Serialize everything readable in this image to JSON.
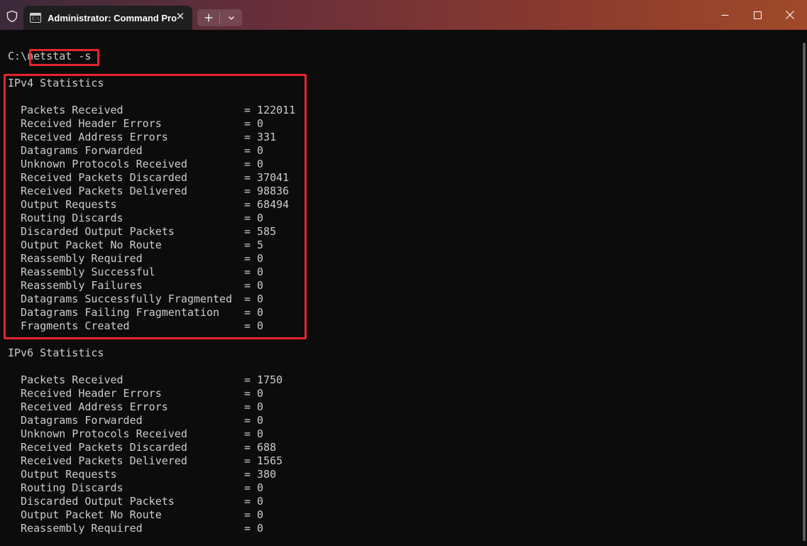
{
  "window": {
    "tab_title": "Administrator: Command Pro",
    "tab_icon_text": "C:\\",
    "colors": {
      "highlight": "#e3262e",
      "terminal_bg": "#0c0c0c",
      "text": "#cccccc"
    }
  },
  "terminal": {
    "prompt": "C:\\",
    "command": "netstat -s",
    "ipv4": {
      "heading": "IPv4 Statistics",
      "rows": [
        {
          "label": "Packets Received",
          "value": "= 122011"
        },
        {
          "label": "Received Header Errors",
          "value": "= 0"
        },
        {
          "label": "Received Address Errors",
          "value": "= 331"
        },
        {
          "label": "Datagrams Forwarded",
          "value": "= 0"
        },
        {
          "label": "Unknown Protocols Received",
          "value": "= 0"
        },
        {
          "label": "Received Packets Discarded",
          "value": "= 37041"
        },
        {
          "label": "Received Packets Delivered",
          "value": "= 98836"
        },
        {
          "label": "Output Requests",
          "value": "= 68494"
        },
        {
          "label": "Routing Discards",
          "value": "= 0"
        },
        {
          "label": "Discarded Output Packets",
          "value": "= 585"
        },
        {
          "label": "Output Packet No Route",
          "value": "= 5"
        },
        {
          "label": "Reassembly Required",
          "value": "= 0"
        },
        {
          "label": "Reassembly Successful",
          "value": "= 0"
        },
        {
          "label": "Reassembly Failures",
          "value": "= 0"
        },
        {
          "label": "Datagrams Successfully Fragmented",
          "value": "= 0"
        },
        {
          "label": "Datagrams Failing Fragmentation",
          "value": "= 0"
        },
        {
          "label": "Fragments Created",
          "value": "= 0"
        }
      ]
    },
    "ipv6": {
      "heading": "IPv6 Statistics",
      "rows": [
        {
          "label": "Packets Received",
          "value": "= 1750"
        },
        {
          "label": "Received Header Errors",
          "value": "= 0"
        },
        {
          "label": "Received Address Errors",
          "value": "= 0"
        },
        {
          "label": "Datagrams Forwarded",
          "value": "= 0"
        },
        {
          "label": "Unknown Protocols Received",
          "value": "= 0"
        },
        {
          "label": "Received Packets Discarded",
          "value": "= 688"
        },
        {
          "label": "Received Packets Delivered",
          "value": "= 1565"
        },
        {
          "label": "Output Requests",
          "value": "= 380"
        },
        {
          "label": "Routing Discards",
          "value": "= 0"
        },
        {
          "label": "Discarded Output Packets",
          "value": "= 0"
        },
        {
          "label": "Output Packet No Route",
          "value": "= 0"
        },
        {
          "label": "Reassembly Required",
          "value": "= 0"
        }
      ]
    }
  }
}
